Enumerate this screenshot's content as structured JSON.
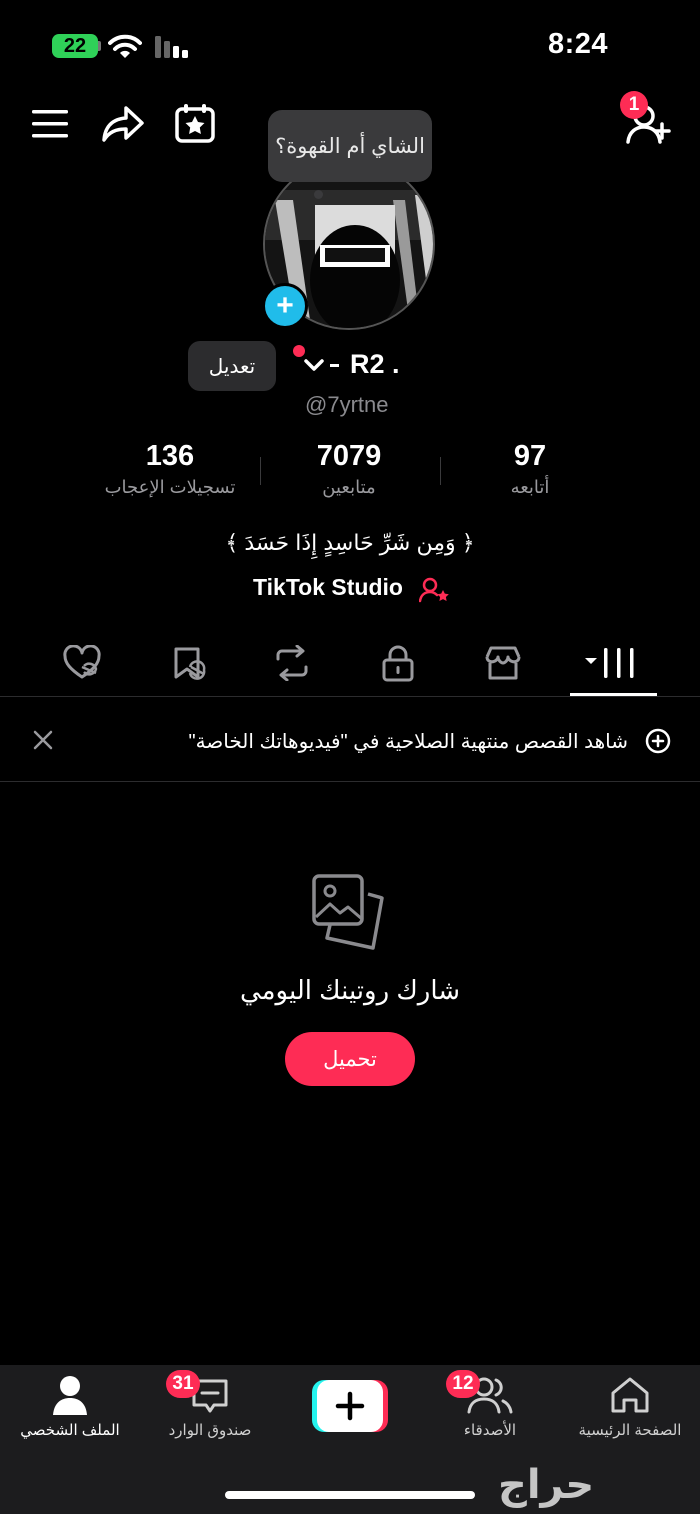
{
  "status_bar": {
    "time": "8:24",
    "battery": "22"
  },
  "header": {
    "notification_count": "1"
  },
  "speech_bubble": "الشاي أم القهوة؟",
  "profile": {
    "edit_label": "تعديل",
    "username": "R2 .",
    "handle": "@7yrtne",
    "stats": [
      {
        "value": "136",
        "label": "تسجيلات الإعجاب"
      },
      {
        "value": "7079",
        "label": "متابعين"
      },
      {
        "value": "97",
        "label": "أتابعه"
      }
    ],
    "bio": "﴿ وَمِن شَرِّ حَاسِدٍ إِذَا حَسَدَ ﴾",
    "studio_link": "TikTok Studio"
  },
  "tabs": [
    "liked-hidden-icon",
    "favorites-icon",
    "reposts-icon",
    "private-icon",
    "shop-icon",
    "videos-grid-icon"
  ],
  "notice": {
    "text": "شاهد القصص منتهية الصلاحية في \"فيديوهاتك الخاصة\""
  },
  "empty_state": {
    "title": "شارك روتينك اليومي",
    "button": "تحميل"
  },
  "bottom_nav": {
    "profile": "الملف الشخصي",
    "inbox": "صندوق الوارد",
    "inbox_badge": "31",
    "friends": "الأصدقاء",
    "friends_badge": "12",
    "home": "الصفحة الرئيسية"
  },
  "watermark": "حراج",
  "colors": {
    "accent": "#fe2c55",
    "blue": "#20bcea",
    "battery": "#2fd158"
  }
}
